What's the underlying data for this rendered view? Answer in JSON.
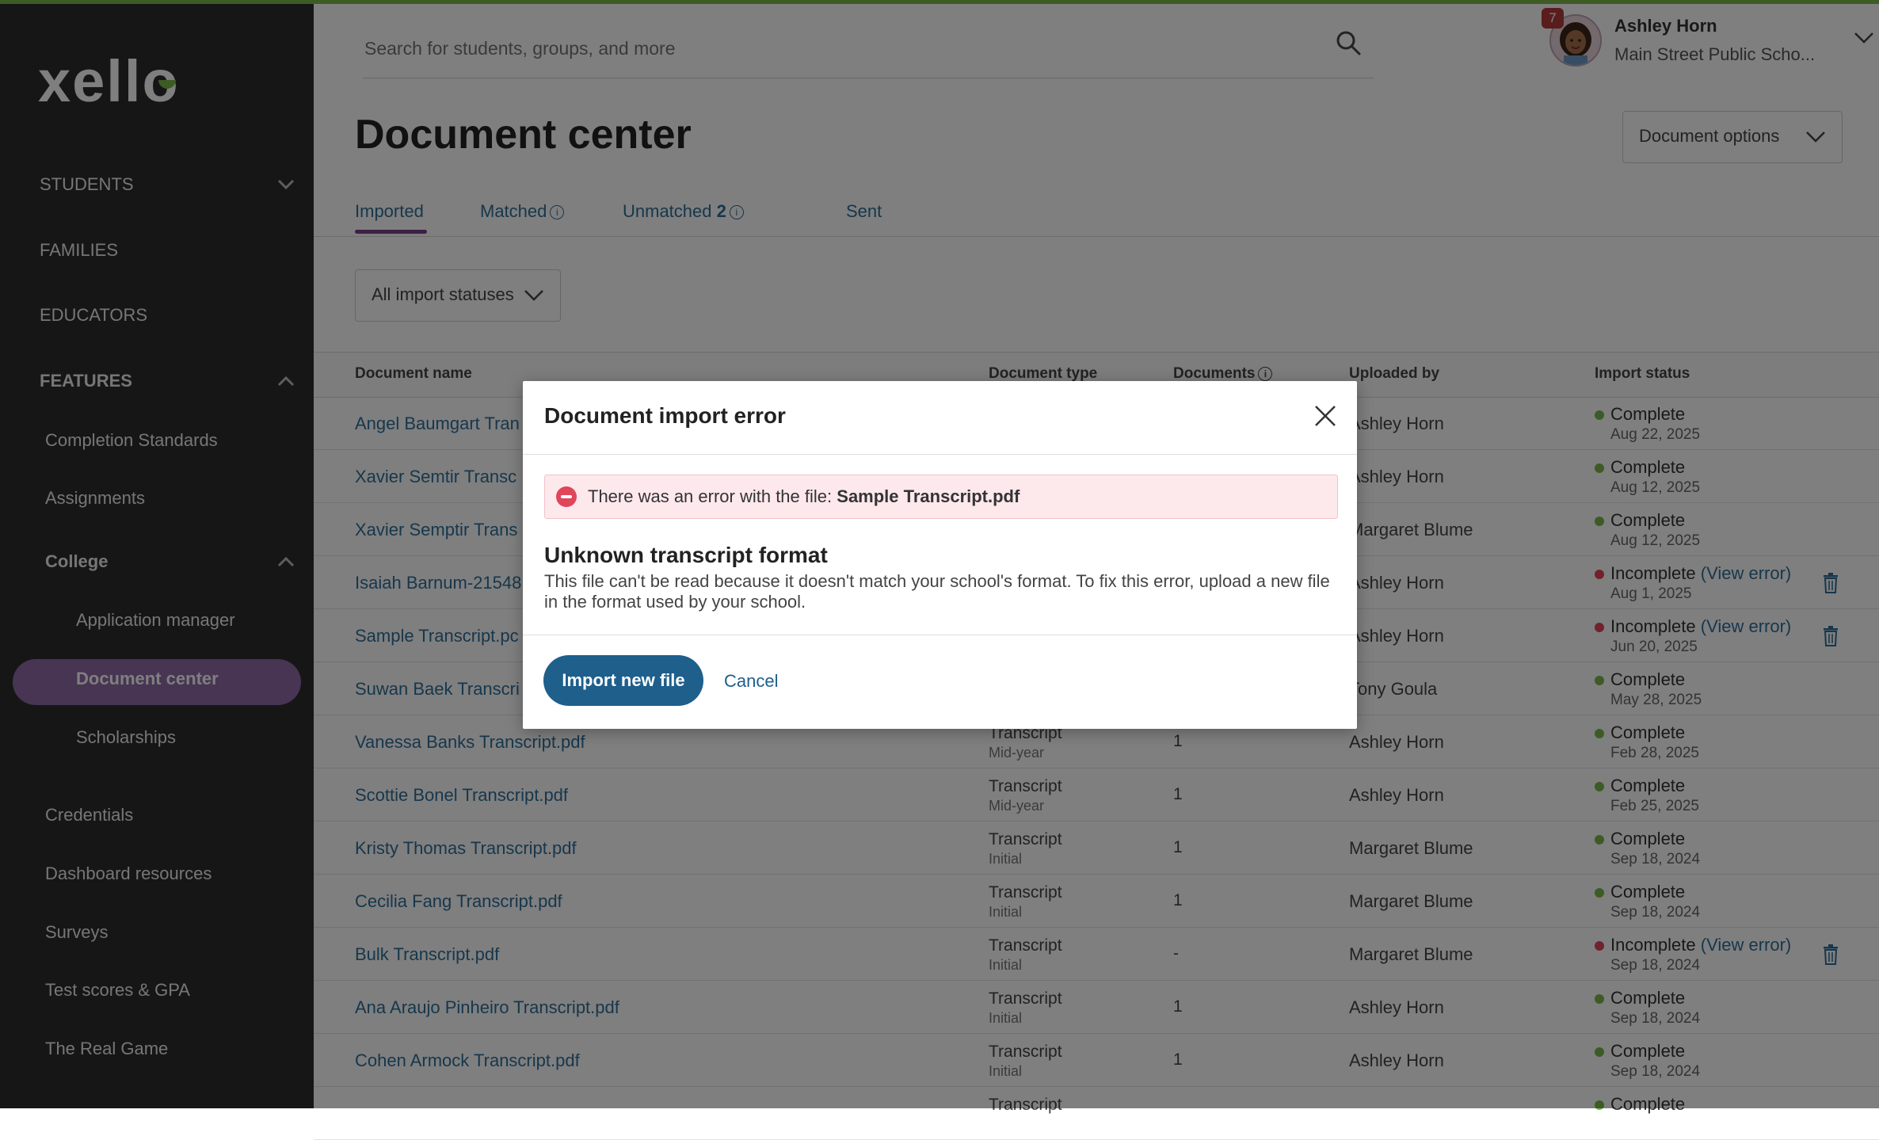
{
  "brand": {
    "logo_text": "xello",
    "accent": "#7ab648",
    "purple": "#8e6aa6"
  },
  "sidebar": {
    "sections": [
      {
        "label": "STUDENTS",
        "expanded": false
      },
      {
        "label": "FAMILIES"
      },
      {
        "label": "EDUCATORS"
      },
      {
        "label": "FEATURES",
        "expanded": true
      }
    ],
    "features": [
      "Completion Standards",
      "Assignments",
      "College",
      "Credentials",
      "Dashboard resources",
      "Surveys",
      "Test scores & GPA",
      "The Real Game"
    ],
    "college_items": [
      "Application manager",
      "Document center",
      "Scholarships"
    ],
    "active_item": "Document center"
  },
  "header": {
    "search_placeholder": "Search for students, groups, and more",
    "user_name": "Ashley Horn",
    "user_school": "Main Street Public Scho...",
    "notification_count": "7"
  },
  "page": {
    "title": "Document center",
    "options_label": "Document options",
    "tabs": [
      {
        "label": "Imported",
        "active": true
      },
      {
        "label": "Matched"
      },
      {
        "label": "Unmatched",
        "count": "2"
      },
      {
        "label": "Sent"
      }
    ],
    "filter_label": "All import statuses"
  },
  "table": {
    "headers": [
      "Document name",
      "Document type",
      "Documents",
      "Uploaded by",
      "Import status"
    ],
    "rows": [
      {
        "name": "Angel Baumgart Tran",
        "type": "",
        "subtype": "",
        "docs": "",
        "uploader": "Ashley Horn",
        "status": "Complete",
        "date": "Aug 22, 2025",
        "error": false
      },
      {
        "name": "Xavier Semtir Transc",
        "type": "",
        "subtype": "",
        "docs": "",
        "uploader": "Ashley Horn",
        "status": "Complete",
        "date": "Aug 12, 2025",
        "error": false
      },
      {
        "name": "Xavier Semptir Trans",
        "type": "",
        "subtype": "",
        "docs": "",
        "uploader": "Margaret Blume",
        "status": "Complete",
        "date": "Aug 12, 2025",
        "error": false
      },
      {
        "name": "Isaiah Barnum-21548",
        "type": "",
        "subtype": "",
        "docs": "",
        "uploader": "Ashley Horn",
        "status": "Incomplete",
        "link": "(View error)",
        "date": "Aug 1, 2025",
        "error": true
      },
      {
        "name": "Sample Transcript.pc",
        "type": "",
        "subtype": "",
        "docs": "",
        "uploader": "Ashley Horn",
        "status": "Incomplete",
        "link": "(View error)",
        "date": "Jun 20, 2025",
        "error": true
      },
      {
        "name": "Suwan Baek Transcri",
        "type": "",
        "subtype": "",
        "docs": "",
        "uploader": "Tony Goula",
        "status": "Complete",
        "date": "May 28, 2025",
        "error": false
      },
      {
        "name": "Vanessa Banks Transcript.pdf",
        "type": "Transcript",
        "subtype": "Mid-year",
        "docs": "1",
        "uploader": "Ashley Horn",
        "status": "Complete",
        "date": "Feb 28, 2025",
        "error": false
      },
      {
        "name": "Scottie Bonel Transcript.pdf",
        "type": "Transcript",
        "subtype": "Mid-year",
        "docs": "1",
        "uploader": "Ashley Horn",
        "status": "Complete",
        "date": "Feb 25, 2025",
        "error": false
      },
      {
        "name": "Kristy Thomas Transcript.pdf",
        "type": "Transcript",
        "subtype": "Initial",
        "docs": "1",
        "uploader": "Margaret Blume",
        "status": "Complete",
        "date": "Sep 18, 2024",
        "error": false
      },
      {
        "name": "Cecilia Fang Transcript.pdf",
        "type": "Transcript",
        "subtype": "Initial",
        "docs": "1",
        "uploader": "Margaret Blume",
        "status": "Complete",
        "date": "Sep 18, 2024",
        "error": false
      },
      {
        "name": "Bulk Transcript.pdf",
        "type": "Transcript",
        "subtype": "Initial",
        "docs": "-",
        "uploader": "Margaret Blume",
        "status": "Incomplete",
        "link": "(View error)",
        "date": "Sep 18, 2024",
        "error": true
      },
      {
        "name": "Ana Araujo Pinheiro Transcript.pdf",
        "type": "Transcript",
        "subtype": "Initial",
        "docs": "1",
        "uploader": "Ashley Horn",
        "status": "Complete",
        "date": "Sep 18, 2024",
        "error": false
      },
      {
        "name": "Cohen Armock Transcript.pdf",
        "type": "Transcript",
        "subtype": "Initial",
        "docs": "1",
        "uploader": "Ashley Horn",
        "status": "Complete",
        "date": "Sep 18, 2024",
        "error": false
      },
      {
        "name": "",
        "type": "Transcript",
        "subtype": "",
        "docs": "",
        "uploader": "",
        "status": "Complete",
        "date": "",
        "error": false
      }
    ],
    "status_colors": {
      "complete": "#7ab648",
      "incomplete": "#e0455a"
    }
  },
  "modal": {
    "title": "Document import error",
    "alert_prefix": "There was an error with the file:",
    "alert_file": "Sample Transcript.pdf",
    "error_title": "Unknown transcript format",
    "error_body": "This file can't be read because it doesn't match your school's format. To fix this error, upload a new file in the format used by your school.",
    "primary_label": "Import new file",
    "cancel_label": "Cancel"
  }
}
